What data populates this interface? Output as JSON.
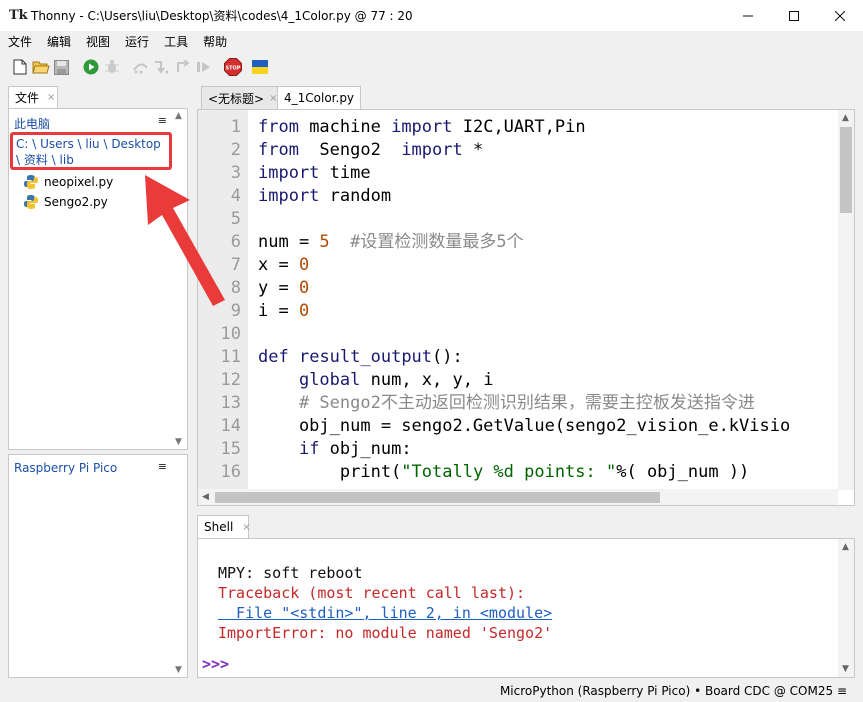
{
  "window": {
    "title": "Thonny  -  C:\\Users\\liu\\Desktop\\资料\\codes\\4_1Color.py  @  77 : 20",
    "app_icon": "Tk"
  },
  "menu": [
    "文件",
    "编辑",
    "视图",
    "运行",
    "工具",
    "帮助"
  ],
  "toolbar": {
    "icons": [
      "new-file-icon",
      "open-folder-icon",
      "save-icon",
      "run-icon",
      "debug-icon",
      "step-over-icon",
      "step-into-icon",
      "step-out-icon",
      "resume-icon",
      "stop-icon",
      "ukraine-flag-icon"
    ],
    "stop_label": "STOP"
  },
  "files": {
    "tab_label": "文件",
    "tab_close": "×",
    "heading": "此电脑",
    "menu_glyph": "≡",
    "path_line1": "C: \\ Users \\ liu \\ Desktop",
    "path_line2": "\\ 资料 \\ lib",
    "items": [
      "neopixel.py",
      "Sengo2.py"
    ]
  },
  "device": {
    "heading": "Raspberry Pi Pico",
    "menu_glyph": "≡"
  },
  "editor": {
    "tabs": [
      {
        "label": "<无标题>",
        "close": "×"
      },
      {
        "label": "4_1Color.py",
        "close": ""
      }
    ],
    "line_numbers": [
      "1",
      "2",
      "3",
      "4",
      "5",
      "6",
      "7",
      "8",
      "9",
      "10",
      "11",
      "12",
      "13",
      "14",
      "15",
      "16"
    ],
    "code": {
      "l1": [
        "from",
        " machine ",
        "import",
        " I2C,UART,Pin"
      ],
      "l2": [
        "from",
        "  Sengo2  ",
        "import",
        " *"
      ],
      "l3": [
        "import",
        " time"
      ],
      "l4": [
        "import",
        " random"
      ],
      "l6": [
        "num = ",
        "5",
        "  #设置检测数量最多5个"
      ],
      "l7": [
        "x = ",
        "0"
      ],
      "l8": [
        "y = ",
        "0"
      ],
      "l9": [
        "i = ",
        "0"
      ],
      "l11": [
        "def",
        " ",
        "result_output",
        "():"
      ],
      "l12": [
        "    ",
        "global",
        " num, x, y, i"
      ],
      "l13": [
        "    # Sengo2不主动返回检测识别结果，需要主控板发送指令进"
      ],
      "l14": [
        "    obj_num = sengo2.GetValue(sengo2_vision_e.kVisio"
      ],
      "l15": [
        "    ",
        "if",
        " obj_num:"
      ],
      "l16": [
        "        print(",
        "\"Totally %d points: \"",
        "%( obj_num ))"
      ]
    }
  },
  "shell": {
    "tab_label": "Shell",
    "tab_close": "×",
    "line1": "MPY: soft reboot",
    "line2": "Traceback (most recent call last):",
    "line3": "  File \"<stdin>\", line 2, in <module>",
    "line4": "ImportError: no module named 'Sengo2'",
    "prompt": ">>>"
  },
  "status": {
    "text": "MicroPython (Raspberry Pi Pico)  •  Board CDC @ COM25  ≡"
  },
  "colors": {
    "annotation": "#e8393d",
    "keyword": "#191970",
    "number": "#b04a00",
    "string": "#006400",
    "comment": "#8a8a8a",
    "error": "#c62828",
    "link": "#1e5fbf",
    "prompt": "#7b2dbf"
  }
}
